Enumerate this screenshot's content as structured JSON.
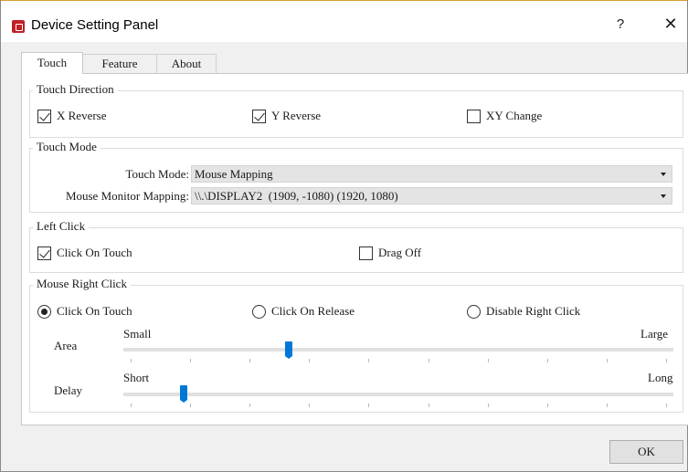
{
  "window": {
    "title": "Device Setting Panel",
    "help_label": "?",
    "close_label": "✕",
    "icon": "app-icon"
  },
  "tabs": [
    {
      "label": "Touch",
      "active": true
    },
    {
      "label": "Feature",
      "active": false
    },
    {
      "label": "About",
      "active": false
    }
  ],
  "touch_direction": {
    "title": "Touch Direction",
    "x_reverse": {
      "label": "X Reverse",
      "checked": true
    },
    "y_reverse": {
      "label": "Y Reverse",
      "checked": true
    },
    "xy_change": {
      "label": "XY Change",
      "checked": false
    }
  },
  "touch_mode": {
    "title": "Touch Mode",
    "mode_label": "Touch Mode:",
    "mode_value": "Mouse Mapping",
    "monitor_label": "Mouse Monitor Mapping:",
    "monitor_value": "\\\\.\\DISPLAY2  (1909, -1080) (1920, 1080)"
  },
  "left_click": {
    "title": "Left Click",
    "click_on_touch": {
      "label": "Click On Touch",
      "checked": true
    },
    "drag_off": {
      "label": "Drag Off",
      "checked": false
    }
  },
  "right_click": {
    "title": "Mouse Right Click",
    "options": [
      {
        "label": "Click On Touch",
        "selected": true
      },
      {
        "label": "Click On Release",
        "selected": false
      },
      {
        "label": "Disable Right Click",
        "selected": false
      }
    ],
    "area": {
      "label": "Area",
      "min_label": "Small",
      "max_label": "Large",
      "value_fraction": 0.3
    },
    "delay": {
      "label": "Delay",
      "min_label": "Short",
      "max_label": "Long",
      "value_fraction": 0.11
    }
  },
  "footer": {
    "ok_label": "OK"
  },
  "colors": {
    "accent": "#0078d7",
    "app_icon": "#c02026"
  }
}
